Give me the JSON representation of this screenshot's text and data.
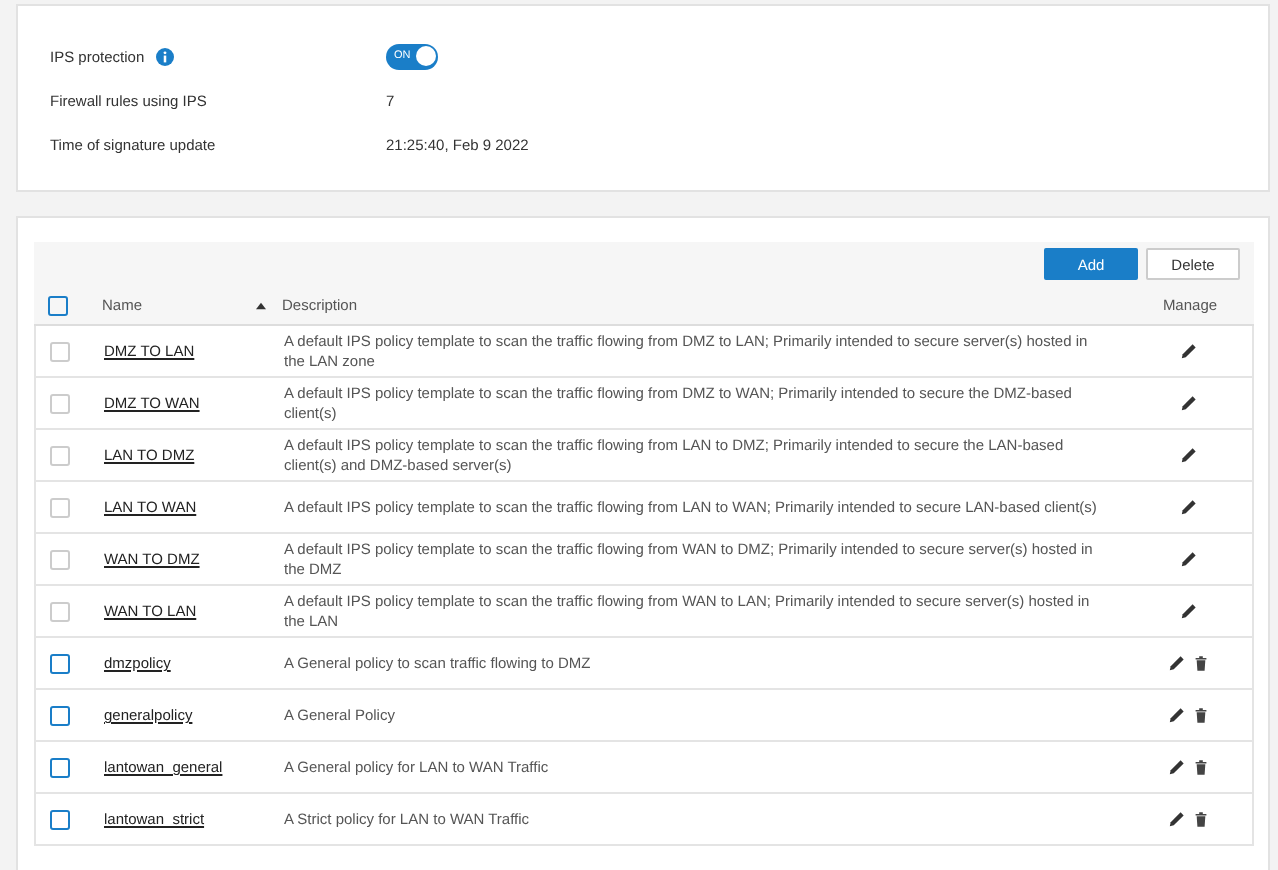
{
  "settings": [
    {
      "kind": "toggle",
      "label": "IPS protection",
      "info": true,
      "value": "ON",
      "on": true
    },
    {
      "kind": "text",
      "label": "Firewall rules using IPS",
      "value": "7"
    },
    {
      "kind": "text",
      "label": "Time of signature update",
      "value": "21:25:40, Feb 9 2022"
    }
  ],
  "toolbar": {
    "buttons": [
      "Add",
      "Delete"
    ]
  },
  "table": {
    "all_checked": false,
    "columns": [
      "Name",
      "Description",
      "Manage"
    ],
    "rows": [
      {
        "kind": "default",
        "name": "DMZ TO LAN",
        "description": "A default IPS policy template to scan the traffic flowing from DMZ to LAN; Primarily intended to secure server(s) hosted in the LAN zone"
      },
      {
        "kind": "default",
        "name": "DMZ TO WAN",
        "description": "A default IPS policy template to scan the traffic flowing from DMZ to WAN; Primarily intended to secure the DMZ-based client(s)"
      },
      {
        "kind": "default",
        "name": "LAN TO DMZ",
        "description": "A default IPS policy template to scan the traffic flowing from LAN to DMZ; Primarily intended to secure the LAN-based client(s) and DMZ-based server(s)"
      },
      {
        "kind": "default",
        "name": "LAN TO WAN",
        "description": "A default IPS policy template to scan the traffic flowing from LAN to WAN; Primarily intended to secure LAN-based client(s)"
      },
      {
        "kind": "default",
        "name": "WAN TO DMZ",
        "description": "A default IPS policy template to scan the traffic flowing from WAN to DMZ; Primarily intended to secure server(s) hosted in the DMZ"
      },
      {
        "kind": "default",
        "name": "WAN TO LAN",
        "description": "A default IPS policy template to scan the traffic flowing from WAN to LAN; Primarily intended to secure server(s) hosted in the LAN"
      },
      {
        "kind": "custom",
        "name": "dmzpolicy",
        "description": "A General policy to scan traffic flowing to DMZ"
      },
      {
        "kind": "custom",
        "name": "generalpolicy",
        "description": "A General Policy"
      },
      {
        "kind": "custom",
        "name": "lantowan_general",
        "description": "A General policy for LAN to WAN Traffic"
      },
      {
        "kind": "custom",
        "name": "lantowan_strict",
        "description": "A Strict policy for LAN to WAN Traffic"
      }
    ]
  }
}
